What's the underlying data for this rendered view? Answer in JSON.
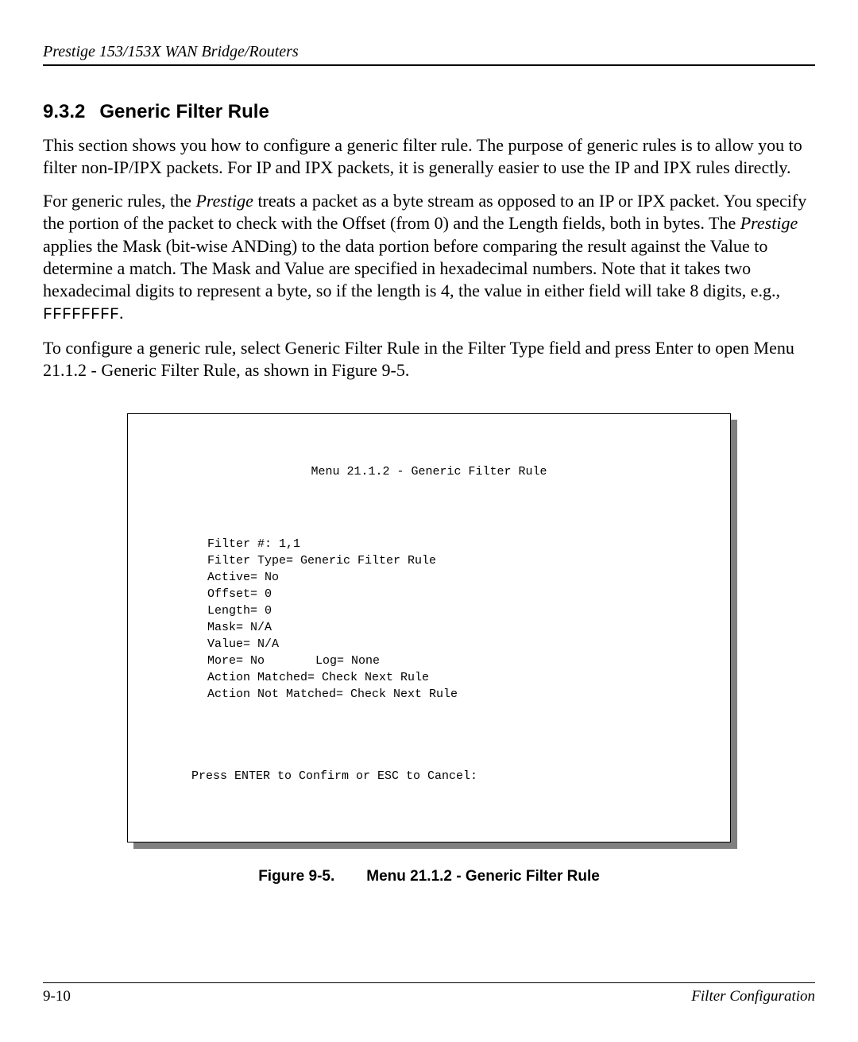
{
  "header": {
    "title": "Prestige 153/153X  WAN Bridge/Routers"
  },
  "section": {
    "number": "9.3.2",
    "title": "Generic Filter Rule"
  },
  "paragraphs": {
    "p1": "This section shows you how to configure a generic filter rule.  The purpose of generic rules is to allow you to filter non-IP/IPX packets.  For IP and IPX packets, it is generally easier to use the IP and IPX rules directly.",
    "p2a": "For generic rules, the ",
    "p2_italic1": "Prestige",
    "p2b": " treats a packet as a byte stream as opposed to an IP or IPX packet. You specify the portion of the packet to check with the Offset (from 0) and the Length fields, both in bytes.  The ",
    "p2_italic2": "Prestige",
    "p2c": " applies the Mask (bit-wise ANDing) to the data portion before comparing the result against the Value to determine a match.  The Mask and Value are specified in hexadecimal numbers.  Note that it takes two hexadecimal digits to represent a byte, so if the length is 4, the value in either field will take 8 digits, e.g., ",
    "p2_code": "FFFFFFFF",
    "p2d": ".",
    "p3": "To configure a generic rule, select Generic Filter Rule in the Filter Type field and press Enter to open Menu 21.1.2 - Generic Filter Rule, as shown in Figure 9-5."
  },
  "terminal": {
    "title": "Menu 21.1.2 - Generic Filter Rule",
    "lines": {
      "l1": "Filter #: 1,1",
      "l2": "Filter Type= Generic Filter Rule",
      "l3": "Active= No",
      "l4": "Offset= 0",
      "l5": "Length= 0",
      "l6": "Mask= N/A",
      "l7": "Value= N/A",
      "l8a": "More= No",
      "l8b": "Log= None",
      "l9": "Action Matched= Check Next Rule",
      "l10": "Action Not Matched= Check Next Rule"
    },
    "footer": "Press ENTER to Confirm or ESC to Cancel:"
  },
  "figure_caption": {
    "number": "Figure 9-5.",
    "text": "Menu 21.1.2 - Generic Filter Rule"
  },
  "footer": {
    "page_number": "9-10",
    "section": "Filter Configuration"
  }
}
